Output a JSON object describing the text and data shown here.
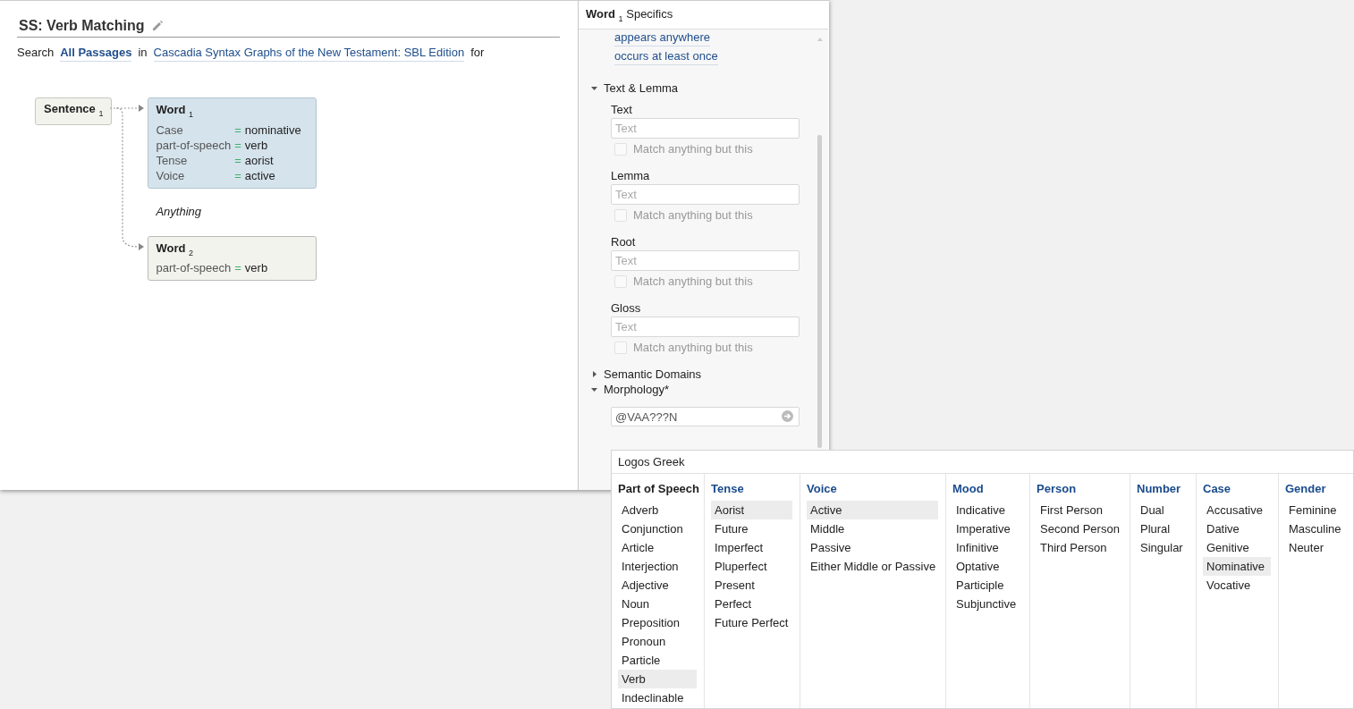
{
  "editor": {
    "title": "SS: Verb Matching",
    "search_line": {
      "prefix": "Search",
      "range": "All Passages",
      "joiner": "in",
      "resource": "Cascadia Syntax Graphs of the New Testament: SBL Edition",
      "suffix": "for"
    },
    "diagram": {
      "root": "Sentence $_{1}$",
      "nodes": [
        {
          "kind": "word",
          "title": "Word $_{1}$",
          "selected": true,
          "attributes": [
            {
              "name": "Case",
              "operator": "=",
              "value": "nominative"
            },
            {
              "name": "part-of-speech",
              "operator": "=",
              "value": "verb"
            },
            {
              "name": "Tense",
              "operator": "=",
              "value": "aorist"
            },
            {
              "name": "Voice",
              "operator": "=",
              "value": "active"
            }
          ]
        },
        {
          "kind": "gap",
          "title": "Anything"
        },
        {
          "kind": "word",
          "title": "Word $_{2}$",
          "selected": false,
          "attributes": [
            {
              "name": "part-of-speech",
              "operator": "=",
              "value": "verb"
            }
          ]
        }
      ]
    }
  },
  "specifics": {
    "title": "**Word** $_{1}$ Specifics",
    "links": [
      "appears anywhere",
      "occurs at least once"
    ],
    "sections": [
      {
        "label": "Text & Lemma",
        "expanded": true,
        "fields": [
          {
            "label": "Text",
            "placeholder": "Text",
            "negate_label": "Match anything but this",
            "negate": false
          },
          {
            "label": "Lemma",
            "placeholder": "Text",
            "negate_label": "Match anything but this",
            "negate": false
          },
          {
            "label": "Root",
            "placeholder": "Text",
            "negate_label": "Match anything but this",
            "negate": false
          },
          {
            "label": "Gloss",
            "placeholder": "Text",
            "negate_label": "Match anything but this",
            "negate": false
          }
        ]
      },
      {
        "label": "Semantic Domains",
        "expanded": false
      },
      {
        "label": "Morphology*",
        "expanded": true,
        "value": "@VAA???N"
      }
    ]
  },
  "morph_popup": {
    "title": "Logos Greek",
    "columns": [
      {
        "heading": "Part of Speech",
        "active": true,
        "items": [
          {
            "label": "Adverb",
            "selected": false
          },
          {
            "label": "Conjunction",
            "selected": false
          },
          {
            "label": "Article",
            "selected": false
          },
          {
            "label": "Interjection",
            "selected": false
          },
          {
            "label": "Adjective",
            "selected": false
          },
          {
            "label": "Noun",
            "selected": false
          },
          {
            "label": "Preposition",
            "selected": false
          },
          {
            "label": "Pronoun",
            "selected": false
          },
          {
            "label": "Particle",
            "selected": false
          },
          {
            "label": "Verb",
            "selected": true
          },
          {
            "label": "Indeclinable",
            "selected": false
          }
        ]
      },
      {
        "heading": "Tense",
        "active": false,
        "items": [
          {
            "label": "Aorist",
            "selected": true
          },
          {
            "label": "Future",
            "selected": false
          },
          {
            "label": "Imperfect",
            "selected": false
          },
          {
            "label": "Pluperfect",
            "selected": false
          },
          {
            "label": "Present",
            "selected": false
          },
          {
            "label": "Perfect",
            "selected": false
          },
          {
            "label": "Future Perfect",
            "selected": false
          }
        ]
      },
      {
        "heading": "Voice",
        "active": false,
        "items": [
          {
            "label": "Active",
            "selected": true
          },
          {
            "label": "Middle",
            "selected": false
          },
          {
            "label": "Passive",
            "selected": false
          },
          {
            "label": "Either Middle or Passive",
            "selected": false
          }
        ]
      },
      {
        "heading": "Mood",
        "active": false,
        "items": [
          {
            "label": "Indicative",
            "selected": false
          },
          {
            "label": "Imperative",
            "selected": false
          },
          {
            "label": "Infinitive",
            "selected": false
          },
          {
            "label": "Optative",
            "selected": false
          },
          {
            "label": "Participle",
            "selected": false
          },
          {
            "label": "Subjunctive",
            "selected": false
          }
        ]
      },
      {
        "heading": "Person",
        "active": false,
        "items": [
          {
            "label": "First Person",
            "selected": false
          },
          {
            "label": "Second Person",
            "selected": false
          },
          {
            "label": "Third Person",
            "selected": false
          }
        ]
      },
      {
        "heading": "Number",
        "active": false,
        "items": [
          {
            "label": "Dual",
            "selected": false
          },
          {
            "label": "Plural",
            "selected": false
          },
          {
            "label": "Singular",
            "selected": false
          }
        ]
      },
      {
        "heading": "Case",
        "active": false,
        "items": [
          {
            "label": "Accusative",
            "selected": false
          },
          {
            "label": "Dative",
            "selected": false
          },
          {
            "label": "Genitive",
            "selected": false
          },
          {
            "label": "Nominative",
            "selected": true
          },
          {
            "label": "Vocative",
            "selected": false
          }
        ]
      },
      {
        "heading": "Gender",
        "active": false,
        "items": [
          {
            "label": "Feminine",
            "selected": false
          },
          {
            "label": "Masculine",
            "selected": false
          },
          {
            "label": "Neuter",
            "selected": false
          }
        ]
      }
    ]
  }
}
